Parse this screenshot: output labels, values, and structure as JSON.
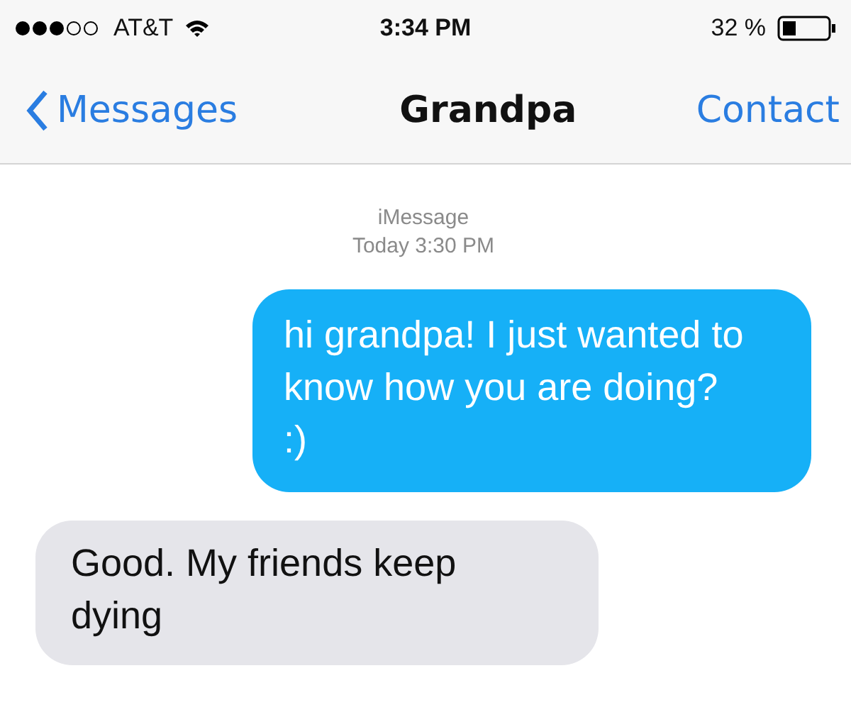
{
  "status_bar": {
    "carrier": "AT&T",
    "time": "3:34 PM",
    "battery": "32 %"
  },
  "nav": {
    "back": "Messages",
    "title": "Grandpa",
    "action": "Contact"
  },
  "thread": {
    "service": "iMessage",
    "timestamp": "Today 3:30 PM"
  },
  "messages": [
    {
      "kind": "sent",
      "text": "hi grandpa! I just wanted to know how you are doing? :)"
    },
    {
      "kind": "received",
      "text": "Good. My friends keep dying"
    }
  ]
}
